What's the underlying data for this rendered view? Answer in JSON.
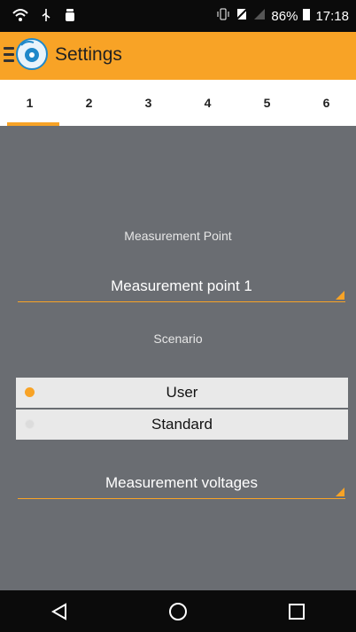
{
  "status_bar": {
    "battery": "86%",
    "time": "17:18",
    "icons": [
      "wifi-icon",
      "usb-icon",
      "android-debug-icon",
      "vibrate-icon",
      "no-sim-icon",
      "signal-icon",
      "battery-icon"
    ]
  },
  "app_bar": {
    "title": "Settings",
    "icons": [
      "menu-icon",
      "app-logo-icon"
    ]
  },
  "tabs": [
    "1",
    "2",
    "3",
    "4",
    "5",
    "6"
  ],
  "active_tab": "1",
  "form": {
    "measurement_point_label": "Measurement Point",
    "measurement_point_value": "Measurement point 1",
    "scenario_label": "Scenario",
    "scenario_options": [
      {
        "label": "User",
        "selected": true
      },
      {
        "label": "Standard",
        "selected": false
      }
    ],
    "voltages_value": "Measurement voltages"
  },
  "nav": [
    "back-icon",
    "home-icon",
    "recents-icon"
  ],
  "colors": {
    "accent": "#f8a326",
    "background": "#6a6d72",
    "status_bar": "#0b0b0b"
  }
}
